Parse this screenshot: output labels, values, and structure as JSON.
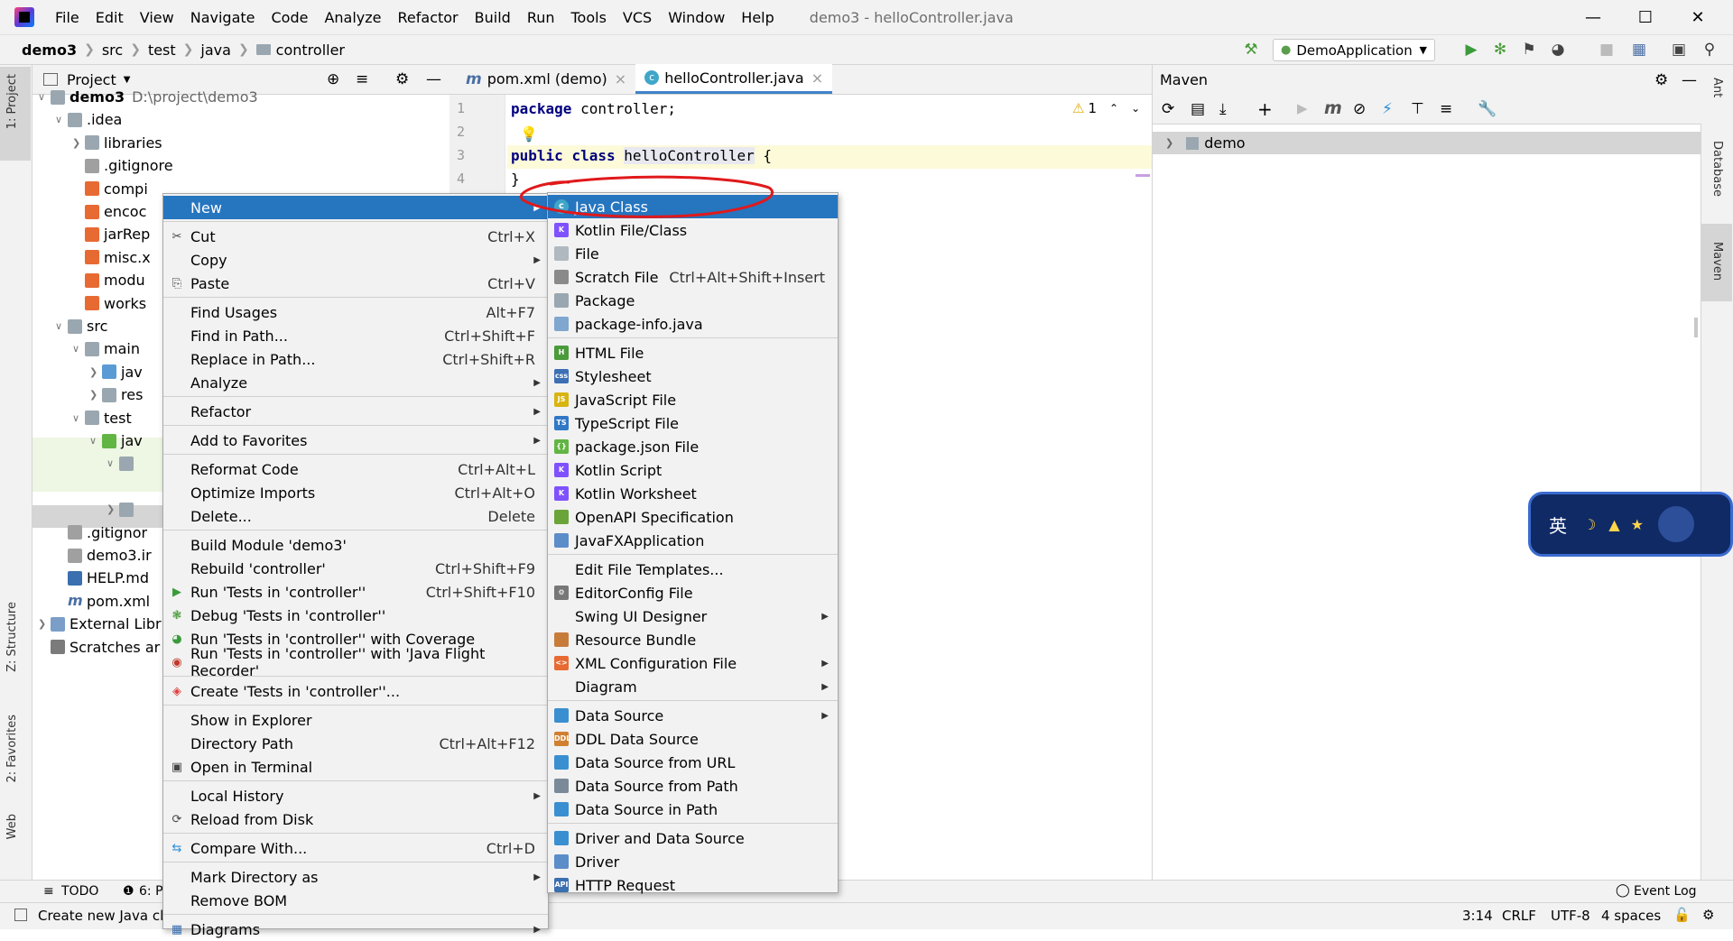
{
  "menubar": {
    "items": [
      "File",
      "Edit",
      "View",
      "Navigate",
      "Code",
      "Analyze",
      "Refactor",
      "Build",
      "Run",
      "Tools",
      "VCS",
      "Window",
      "Help"
    ],
    "window_title": "demo3 - helloController.java"
  },
  "breadcrumb": [
    "demo3",
    "src",
    "test",
    "java",
    "controller"
  ],
  "toolbar": {
    "run_config": "DemoApplication"
  },
  "left_strip": {
    "project": "1: Project",
    "structure": "Z: Structure",
    "favorites": "2: Favorites",
    "web": "Web"
  },
  "right_strip": {
    "ant": "Ant",
    "database": "Database",
    "maven": "Maven"
  },
  "project_panel": {
    "title": "Project",
    "rows": [
      {
        "text": "demo3",
        "extra": "D:\\project\\demo3",
        "indent": 0,
        "arrow": "v",
        "icon": "folder"
      },
      {
        "text": ".idea",
        "indent": 1,
        "arrow": "v",
        "icon": "folder"
      },
      {
        "text": "libraries",
        "indent": 2,
        "arrow": ">",
        "icon": "folder"
      },
      {
        "text": ".gitignore",
        "indent": 2,
        "arrow": "",
        "icon": "file"
      },
      {
        "text": "compi",
        "indent": 2,
        "arrow": "",
        "icon": "xml"
      },
      {
        "text": "encoc",
        "indent": 2,
        "arrow": "",
        "icon": "xml"
      },
      {
        "text": "jarRep",
        "indent": 2,
        "arrow": "",
        "icon": "xml"
      },
      {
        "text": "misc.x",
        "indent": 2,
        "arrow": "",
        "icon": "xml"
      },
      {
        "text": "modu",
        "indent": 2,
        "arrow": "",
        "icon": "xml"
      },
      {
        "text": "works",
        "indent": 2,
        "arrow": "",
        "icon": "xml"
      },
      {
        "text": "src",
        "indent": 1,
        "arrow": "v",
        "icon": "folder"
      },
      {
        "text": "main",
        "indent": 2,
        "arrow": "v",
        "icon": "folder"
      },
      {
        "text": "jav",
        "indent": 3,
        "arrow": ">",
        "icon": "bluefolder"
      },
      {
        "text": "res",
        "indent": 3,
        "arrow": ">",
        "icon": "resfolder"
      },
      {
        "text": "test",
        "indent": 2,
        "arrow": "v",
        "icon": "folder"
      },
      {
        "text": "jav",
        "indent": 3,
        "arrow": "v",
        "icon": "greenfolder"
      },
      {
        "text": "",
        "indent": 4,
        "arrow": "v",
        "icon": "folder"
      },
      {
        "text": "",
        "indent": 4,
        "arrow": "",
        "icon": ""
      },
      {
        "text": "",
        "indent": 4,
        "arrow": ">",
        "icon": "folder"
      },
      {
        "text": ".gitignor",
        "indent": 1,
        "arrow": "",
        "icon": "file"
      },
      {
        "text": "demo3.ir",
        "indent": 1,
        "arrow": "",
        "icon": "file"
      },
      {
        "text": "HELP.md",
        "indent": 1,
        "arrow": "",
        "icon": "md"
      },
      {
        "text": "pom.xml",
        "indent": 1,
        "arrow": "",
        "icon": "maven"
      },
      {
        "text": "External Libr",
        "indent": 0,
        "arrow": ">",
        "icon": "lib"
      },
      {
        "text": "Scratches ar",
        "indent": 0,
        "arrow": "",
        "icon": "scratch"
      }
    ]
  },
  "tabs": [
    {
      "label": "pom.xml (demo)",
      "icon": "m",
      "active": false
    },
    {
      "label": "helloController.java",
      "icon": "c",
      "active": true
    }
  ],
  "editor": {
    "lines": [
      {
        "num": "1",
        "code": "package controller;"
      },
      {
        "num": "2",
        "code": ""
      },
      {
        "num": "3",
        "code": "public class helloController {"
      },
      {
        "num": "4",
        "code": "}"
      }
    ],
    "warnings": "1",
    "kw_package": "package",
    "pkg_name": " controller;",
    "kw_public": "public",
    "kw_class": "class",
    "class_name": "helloController",
    "brace_open": " {",
    "brace_close": "}"
  },
  "maven_panel": {
    "title": "Maven",
    "root": "demo"
  },
  "context_menu": {
    "items": [
      {
        "label": "New",
        "shortcut": "",
        "submenu": true,
        "selected": true,
        "icon": ""
      },
      {
        "sep": true
      },
      {
        "label": "Cut",
        "shortcut": "Ctrl+X",
        "icon": "scissors"
      },
      {
        "label": "Copy",
        "shortcut": "",
        "submenu": true,
        "icon": ""
      },
      {
        "label": "Paste",
        "shortcut": "Ctrl+V",
        "icon": "clipboard"
      },
      {
        "sep": true
      },
      {
        "label": "Find Usages",
        "shortcut": "Alt+F7",
        "icon": ""
      },
      {
        "label": "Find in Path...",
        "shortcut": "Ctrl+Shift+F",
        "icon": ""
      },
      {
        "label": "Replace in Path...",
        "shortcut": "Ctrl+Shift+R",
        "icon": ""
      },
      {
        "label": "Analyze",
        "shortcut": "",
        "submenu": true,
        "icon": ""
      },
      {
        "sep": true
      },
      {
        "label": "Refactor",
        "shortcut": "",
        "submenu": true,
        "icon": ""
      },
      {
        "sep": true
      },
      {
        "label": "Add to Favorites",
        "shortcut": "",
        "submenu": true,
        "icon": ""
      },
      {
        "sep": true
      },
      {
        "label": "Reformat Code",
        "shortcut": "Ctrl+Alt+L",
        "icon": ""
      },
      {
        "label": "Optimize Imports",
        "shortcut": "Ctrl+Alt+O",
        "icon": ""
      },
      {
        "label": "Delete...",
        "shortcut": "Delete",
        "icon": ""
      },
      {
        "sep": true
      },
      {
        "label": "Build Module 'demo3'",
        "shortcut": "",
        "icon": ""
      },
      {
        "label": "Rebuild 'controller'",
        "shortcut": "Ctrl+Shift+F9",
        "icon": ""
      },
      {
        "label": "Run 'Tests in 'controller''",
        "shortcut": "Ctrl+Shift+F10",
        "icon": "run"
      },
      {
        "label": "Debug 'Tests in 'controller''",
        "shortcut": "",
        "icon": "debug"
      },
      {
        "label": "Run 'Tests in 'controller'' with Coverage",
        "shortcut": "",
        "icon": "coverage"
      },
      {
        "label": "Run 'Tests in 'controller'' with 'Java Flight Recorder'",
        "shortcut": "",
        "icon": "jfr"
      },
      {
        "sep": true
      },
      {
        "label": "Create 'Tests in 'controller''...",
        "shortcut": "",
        "icon": "create"
      },
      {
        "sep": true
      },
      {
        "label": "Show in Explorer",
        "shortcut": "",
        "icon": ""
      },
      {
        "label": "Directory Path",
        "shortcut": "Ctrl+Alt+F12",
        "icon": ""
      },
      {
        "label": "Open in Terminal",
        "shortcut": "",
        "icon": "terminal"
      },
      {
        "sep": true
      },
      {
        "label": "Local History",
        "shortcut": "",
        "submenu": true,
        "icon": ""
      },
      {
        "label": "Reload from Disk",
        "shortcut": "",
        "icon": "reload"
      },
      {
        "sep": true
      },
      {
        "label": "Compare With...",
        "shortcut": "Ctrl+D",
        "icon": "compare"
      },
      {
        "sep": true
      },
      {
        "label": "Mark Directory as",
        "shortcut": "",
        "submenu": true,
        "icon": ""
      },
      {
        "label": "Remove BOM",
        "shortcut": "",
        "icon": ""
      },
      {
        "sep": true
      },
      {
        "label": "Diagrams",
        "shortcut": "",
        "submenu": true,
        "icon": "diagram"
      }
    ]
  },
  "new_submenu": {
    "items": [
      {
        "label": "Java Class",
        "shortcut": "",
        "selected": true,
        "icon": "java"
      },
      {
        "label": "Kotlin File/Class",
        "shortcut": "",
        "icon": "kotlin"
      },
      {
        "label": "File",
        "shortcut": "",
        "icon": "file"
      },
      {
        "label": "Scratch File",
        "shortcut": "Ctrl+Alt+Shift+Insert",
        "icon": "scratch"
      },
      {
        "label": "Package",
        "shortcut": "",
        "icon": "package"
      },
      {
        "label": "package-info.java",
        "shortcut": "",
        "icon": "pkginfo"
      },
      {
        "sep": true
      },
      {
        "label": "HTML File",
        "shortcut": "",
        "icon": "html"
      },
      {
        "label": "Stylesheet",
        "shortcut": "",
        "icon": "css"
      },
      {
        "label": "JavaScript File",
        "shortcut": "",
        "icon": "js"
      },
      {
        "label": "TypeScript File",
        "shortcut": "",
        "icon": "ts"
      },
      {
        "label": "package.json File",
        "shortcut": "",
        "icon": "pkgjson"
      },
      {
        "label": "Kotlin Script",
        "shortcut": "",
        "icon": "kotlin"
      },
      {
        "label": "Kotlin Worksheet",
        "shortcut": "",
        "icon": "kotlin"
      },
      {
        "label": "OpenAPI Specification",
        "shortcut": "",
        "icon": "openapi"
      },
      {
        "label": "JavaFXApplication",
        "shortcut": "",
        "icon": "javafx"
      },
      {
        "sep": true
      },
      {
        "label": "Edit File Templates...",
        "shortcut": "",
        "icon": ""
      },
      {
        "label": "EditorConfig File",
        "shortcut": "",
        "icon": "gear"
      },
      {
        "label": "Swing UI Designer",
        "shortcut": "",
        "submenu": true,
        "icon": ""
      },
      {
        "label": "Resource Bundle",
        "shortcut": "",
        "icon": "bundle"
      },
      {
        "label": "XML Configuration File",
        "shortcut": "",
        "submenu": true,
        "icon": "xml"
      },
      {
        "label": "Diagram",
        "shortcut": "",
        "submenu": true,
        "icon": ""
      },
      {
        "sep": true
      },
      {
        "label": "Data Source",
        "shortcut": "",
        "submenu": true,
        "icon": "db"
      },
      {
        "label": "DDL Data Source",
        "shortcut": "",
        "icon": "ddl"
      },
      {
        "label": "Data Source from URL",
        "shortcut": "",
        "icon": "db"
      },
      {
        "label": "Data Source from Path",
        "shortcut": "",
        "icon": "dbfolder"
      },
      {
        "label": "Data Source in Path",
        "shortcut": "",
        "icon": "db"
      },
      {
        "sep": true
      },
      {
        "label": "Driver and Data Source",
        "shortcut": "",
        "icon": "db"
      },
      {
        "label": "Driver",
        "shortcut": "",
        "icon": "driver"
      },
      {
        "label": "HTTP Request",
        "shortcut": "",
        "icon": "api"
      }
    ]
  },
  "bottom_tools": {
    "todo": "TODO",
    "problems": "6: P",
    "event_log": "Event Log"
  },
  "status": {
    "message": "Create new Java cl",
    "position": "3:14",
    "line_sep": "CRLF",
    "encoding": "UTF-8",
    "indent": "4 spaces"
  },
  "ime": {
    "label": "英"
  },
  "icons": {
    "java_class": "c",
    "maven": "m"
  }
}
